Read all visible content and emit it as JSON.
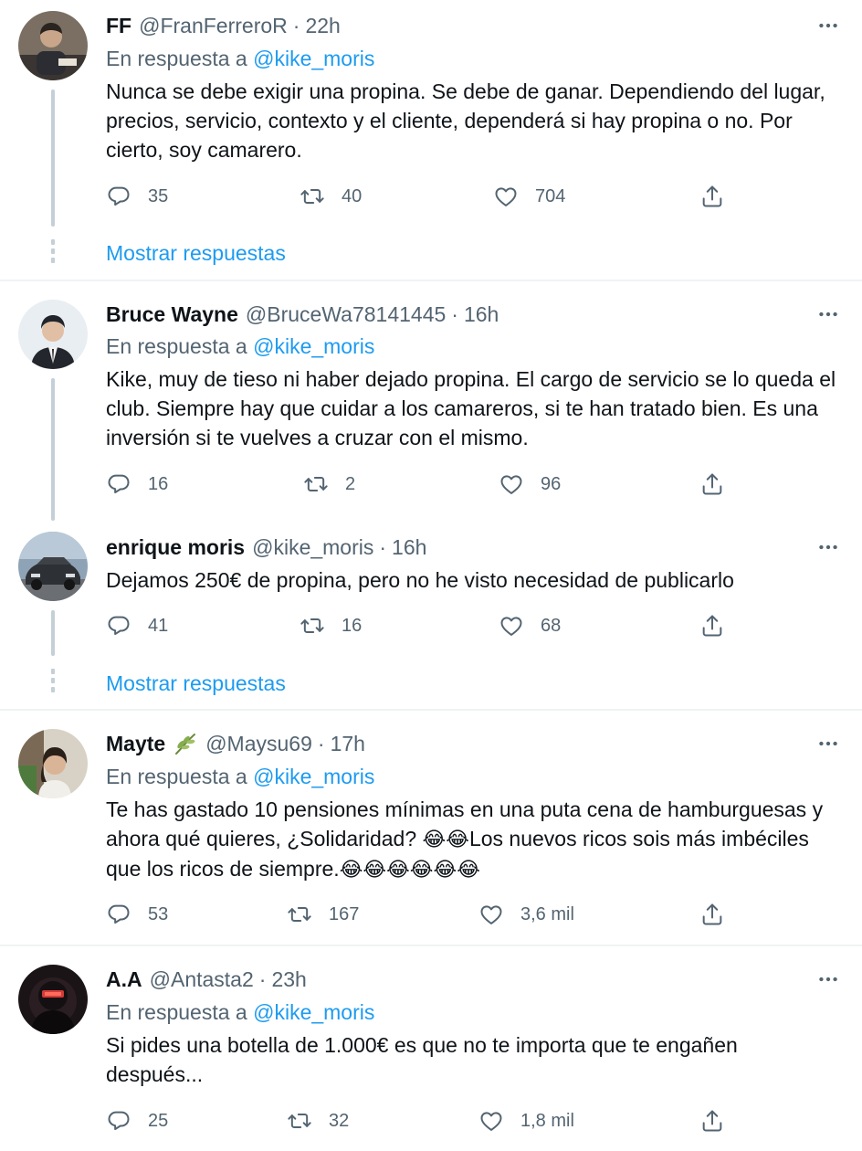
{
  "common": {
    "reply_prefix": "En respuesta a",
    "show_replies": "Mostrar respuestas",
    "separator": "·"
  },
  "tweets": [
    {
      "name": "FF",
      "handle": "@FranFerreroR",
      "time": "22h",
      "reply_to": "@kike_moris",
      "text": "Nunca se debe exigir una propina. Se debe de ganar. Dependiendo del lugar, precios, servicio, contexto y el cliente, dependerá si hay propina o no. Por cierto, soy camarero.",
      "replies": "35",
      "retweets": "40",
      "likes": "704"
    },
    {
      "name": "Bruce Wayne",
      "handle": "@BruceWa78141445",
      "time": "16h",
      "reply_to": "@kike_moris",
      "text": "Kike, muy de tieso ni haber dejado propina. El cargo de servicio se lo queda el club. Siempre hay que cuidar a los camareros, si te han tratado bien. Es una inversión si te vuelves a cruzar con el mismo.",
      "replies": "16",
      "retweets": "2",
      "likes": "96"
    },
    {
      "name": "enrique moris",
      "handle": "@kike_moris",
      "time": "16h",
      "text": "Dejamos 250€ de propina, pero no he visto necesidad de publicarlo",
      "replies": "41",
      "retweets": "16",
      "likes": "68"
    },
    {
      "name": "Mayte",
      "handle": "@Maysu69",
      "time": "17h",
      "reply_to": "@kike_moris",
      "text_a": "Te has gastado 10 pensiones mínimas en una puta cena de hamburguesas y ahora qué quieres, ¿Solidaridad? ",
      "emoji_a": "😂😂",
      "text_b": "Los nuevos ricos sois más imbéciles que los ricos de siempre.",
      "emoji_b": "😂😂😂😂😂😂",
      "replies": "53",
      "retweets": "167",
      "likes": "3,6 mil"
    },
    {
      "name": "A.A",
      "handle": "@Antasta2",
      "time": "23h",
      "reply_to": "@kike_moris",
      "text": "Si pides una botella de 1.000€ es que no te importa que te engañen después...",
      "replies": "25",
      "retweets": "32",
      "likes": "1,8 mil"
    }
  ],
  "colors": {
    "text": "#0f1419",
    "secondary": "#536471",
    "link": "#1d9bf0",
    "thread_line": "#c4cfd6",
    "divider": "#eff3f4"
  },
  "icons": [
    "reply-icon",
    "retweet-icon",
    "like-icon",
    "share-icon",
    "more-icon",
    "leaf-emoji-icon"
  ]
}
